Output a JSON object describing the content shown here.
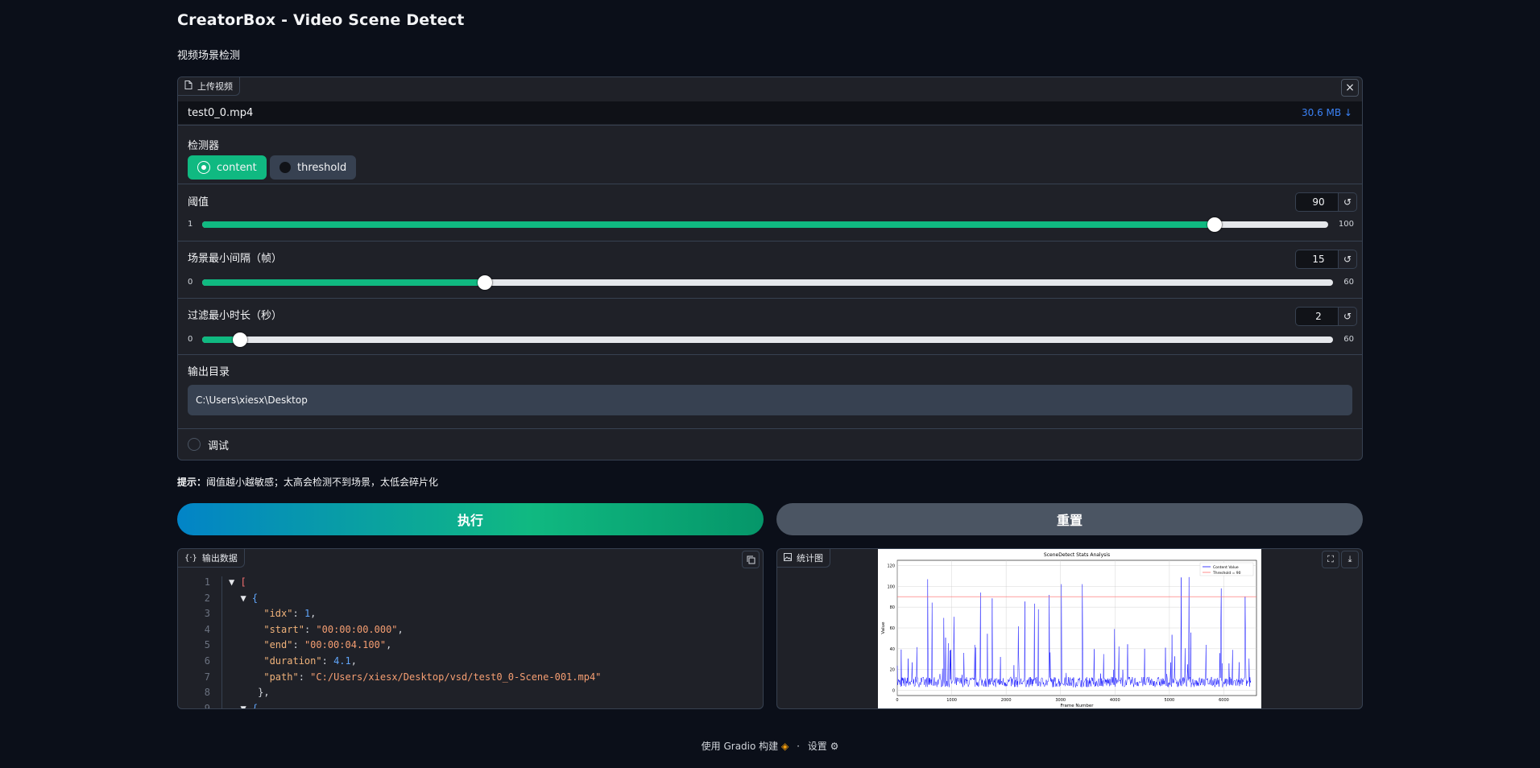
{
  "app": {
    "title": "CreatorBox - Video Scene Detect",
    "subtitle": "视频场景检测"
  },
  "upload": {
    "tag_label": "上传视频",
    "file_name": "test0_0.mp4",
    "file_size": "30.6 MB ↓",
    "close_icon": "×"
  },
  "detector": {
    "label": "检测器",
    "options": [
      "content",
      "threshold"
    ],
    "selected": "content"
  },
  "threshold": {
    "label": "阈值",
    "value": "90",
    "min": "1",
    "max": "100",
    "level": 0.899
  },
  "min_gap": {
    "label": "场景最小间隔（帧）",
    "value": "15",
    "min": "0",
    "max": "60",
    "level": 0.25
  },
  "min_duration": {
    "label": "过滤最小时长（秒）",
    "value": "2",
    "min": "0",
    "max": "60",
    "level": 0.0333
  },
  "output_dir": {
    "label": "输出目录",
    "value": "C:\\Users\\xiesx\\Desktop"
  },
  "debug": {
    "label": "调试",
    "checked": false
  },
  "hint": {
    "prefix": "提示：",
    "text": "阈值越小越敏感；太高会检测不到场景，太低会碎片化"
  },
  "actions": {
    "run_label": "执行",
    "reset_label": "重置"
  },
  "output_data": {
    "tag_label": "输出数据",
    "lines": [
      {
        "n": "1",
        "text": "["
      },
      {
        "n": "2",
        "text": "{"
      },
      {
        "n": "3",
        "key": "\"idx\"",
        "val": "1",
        "type": "num"
      },
      {
        "n": "4",
        "key": "\"start\"",
        "val": "\"00:00:00.000\"",
        "type": "str"
      },
      {
        "n": "5",
        "key": "\"end\"",
        "val": "\"00:00:04.100\"",
        "type": "str"
      },
      {
        "n": "6",
        "key": "\"duration\"",
        "val": "4.1",
        "type": "num"
      },
      {
        "n": "7",
        "key": "\"path\"",
        "val": "\"C:/Users/xiesx/Desktop/vsd/test0_0-Scene-001.mp4\"",
        "type": "str"
      },
      {
        "n": "8",
        "text": "},"
      },
      {
        "n": "9",
        "text": "{"
      }
    ]
  },
  "stats_plot": {
    "tag_label": "统计图",
    "chart_title": "SceneDetect Stats Analysis",
    "xlabel": "Frame Number",
    "ylabel": "Value",
    "legend": [
      "Content Value",
      "Threshold = 90"
    ],
    "x_ticks": [
      "0",
      "1000",
      "2000",
      "3000",
      "4000",
      "5000",
      "6000"
    ],
    "y_ticks": [
      "0",
      "20",
      "40",
      "60",
      "80",
      "100",
      "120"
    ],
    "xlim": [
      0,
      6600
    ],
    "ylim": [
      -5,
      125
    ],
    "threshold_value": 90,
    "colors": {
      "series": "#0000ff",
      "threshold": "#ff6666"
    }
  },
  "footer": {
    "built_with": "使用 Gradio 构建",
    "settings": "设置",
    "separator": "·"
  }
}
